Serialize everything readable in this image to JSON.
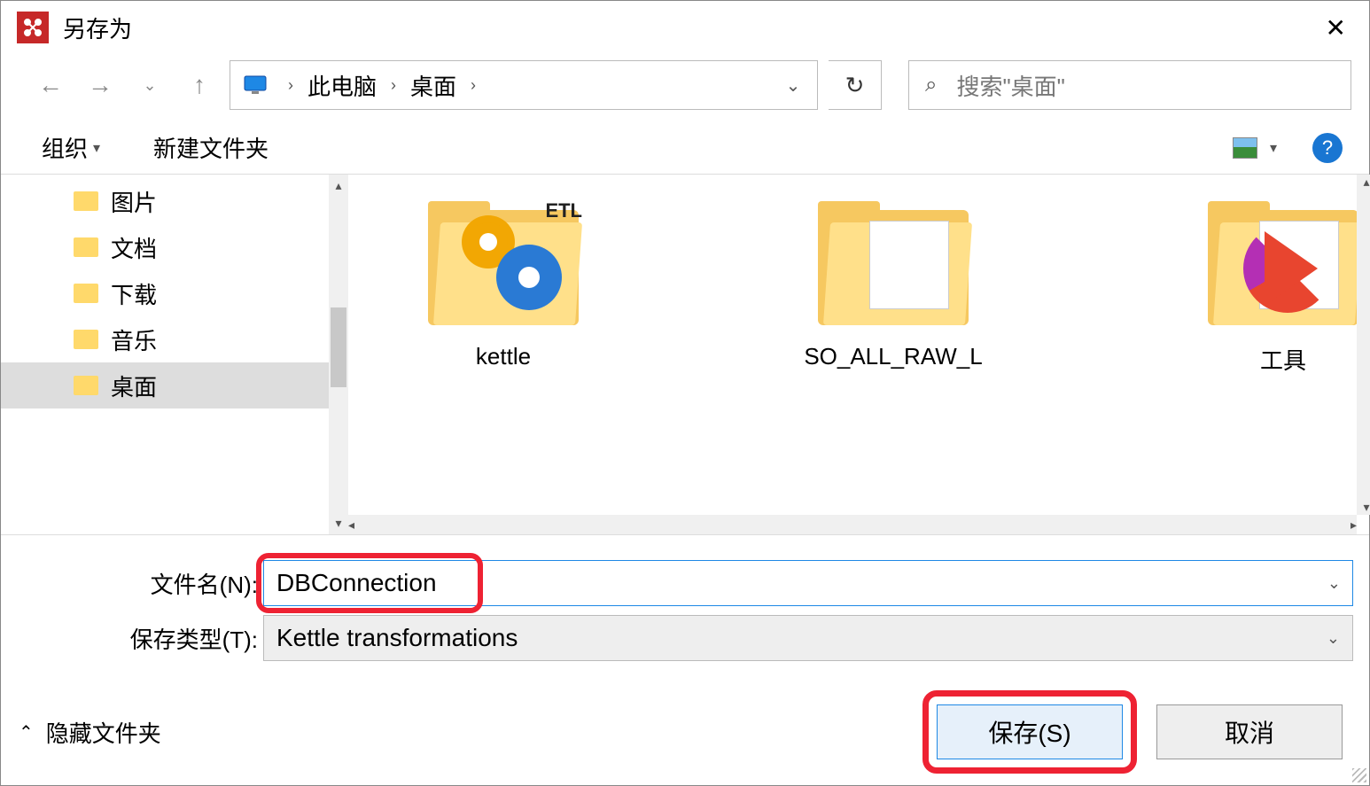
{
  "titlebar": {
    "title": "另存为"
  },
  "breadcrumb": {
    "pc": "此电脑",
    "desktop": "桌面"
  },
  "search": {
    "placeholder": "搜索\"桌面\""
  },
  "toolbar": {
    "organize": "组织",
    "new_folder": "新建文件夹"
  },
  "sidebar": {
    "items": [
      {
        "label": "图片"
      },
      {
        "label": "文档"
      },
      {
        "label": "下载"
      },
      {
        "label": "音乐"
      },
      {
        "label": "桌面"
      }
    ]
  },
  "files": [
    {
      "label": "kettle"
    },
    {
      "label": "SO_ALL_RAW_L"
    },
    {
      "label": "工具"
    }
  ],
  "form": {
    "filename_label": "文件名(N):",
    "filetype_label": "保存类型(T):",
    "filename_value": "DBConnection",
    "filetype_value": "Kettle transformations"
  },
  "bottom": {
    "hide_folders": "隐藏文件夹",
    "save": "保存(S)",
    "cancel": "取消"
  },
  "overlay": {
    "etl": "ETL"
  }
}
